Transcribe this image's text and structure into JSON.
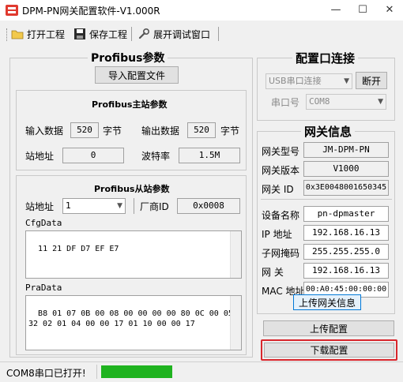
{
  "window": {
    "title": "DPM-PN网关配置软件-V1.000R",
    "minimize_glyph": "—",
    "maximize_glyph": "☐",
    "close_glyph": "✕"
  },
  "toolbar": {
    "open_label": "打开工程",
    "save_label": "保存工程",
    "debug_label": "展开调试窗口"
  },
  "profibus": {
    "group_title": "Profibus参数",
    "import_label": "导入配置文件",
    "master": {
      "title": "Profibus主站参数",
      "input_label": "输入数据",
      "input_value": "520",
      "input_unit": "字节",
      "output_label": "输出数据",
      "output_value": "520",
      "output_unit": "字节",
      "station_label": "站地址",
      "station_value": "0",
      "baud_label": "波特率",
      "baud_value": "1.5M"
    },
    "slave": {
      "title": "Profibus从站参数",
      "station_label": "站地址",
      "station_value": "1",
      "vendor_label": "厂商ID",
      "vendor_value": "0x0008",
      "cfg_label": "CfgData",
      "cfg_value": "11 21 DF D7 EF E7",
      "prm_label": "PraData",
      "prm_value": "B8 01 07 0B 00 08 00 00 00 00 80 0C 00 05\n32 02 01 04 00 00 17 01 10 00 00 17"
    }
  },
  "config_port": {
    "title": "配置口连接",
    "connection_type": "USB串口连接",
    "open_label": "断开",
    "port_label": "串口号",
    "port_value": "COM8"
  },
  "gateway": {
    "title": "网关信息",
    "model_label": "网关型号",
    "model_value": "JM-DPM-PN",
    "version_label": "网关版本",
    "version_value": "V1000",
    "id_label": "网关 ID",
    "id_value": "0x3E0048001650345",
    "device_label": "设备名称",
    "device_value": "pn-dpmaster",
    "ip_label": "IP  地址",
    "ip_value": "192.168.16.13",
    "mask_label": "子网掩码",
    "mask_value": "255.255.255.0",
    "gw_label": "网    关",
    "gw_value": "192.168.16.13",
    "mac_label": "MAC 地址",
    "mac_value": "00:A0:45:00:00:00",
    "upload_info_label": "上传网关信息"
  },
  "actions": {
    "upload_label": "上传配置",
    "download_label": "下载配置"
  },
  "status": {
    "text": "COM8串口已打开!",
    "indicator_color": "#1fb31f",
    "highlight_color": "#d8262c"
  }
}
